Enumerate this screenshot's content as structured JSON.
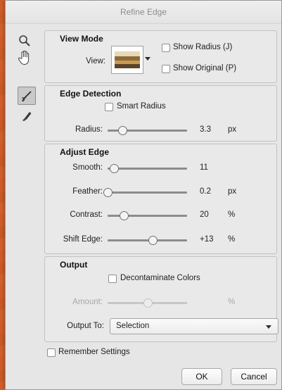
{
  "dialog": {
    "title": "Refine Edge"
  },
  "tools": [
    {
      "name": "zoom-tool",
      "icon": "magnifier-icon"
    },
    {
      "name": "hand-tool",
      "icon": "hand-icon"
    },
    {
      "name": "refine-radius-tool",
      "icon": "brush-icon",
      "selected": true
    },
    {
      "name": "erase-refinements-tool",
      "icon": "eraser-brush-icon"
    }
  ],
  "view_mode": {
    "title": "View Mode",
    "view_label": "View:",
    "show_radius": {
      "label": "Show Radius (J)",
      "checked": false
    },
    "show_original": {
      "label": "Show Original (P)",
      "checked": false
    }
  },
  "edge_detection": {
    "title": "Edge Detection",
    "smart_radius": {
      "label": "Smart Radius",
      "checked": false
    },
    "radius": {
      "label": "Radius:",
      "value": "3.3",
      "unit": "px",
      "slider_fraction": 0.19
    }
  },
  "adjust_edge": {
    "title": "Adjust Edge",
    "smooth": {
      "label": "Smooth:",
      "value": "11",
      "unit": "",
      "slider_fraction": 0.08
    },
    "feather": {
      "label": "Feather:",
      "value": "0.2",
      "unit": "px",
      "slider_fraction": 0.0
    },
    "contrast": {
      "label": "Contrast:",
      "value": "20",
      "unit": "%",
      "slider_fraction": 0.2
    },
    "shift_edge": {
      "label": "Shift Edge:",
      "value": "+13",
      "unit": "%",
      "slider_fraction": 0.565
    }
  },
  "output": {
    "title": "Output",
    "decontaminate": {
      "label": "Decontaminate Colors",
      "checked": false
    },
    "amount": {
      "label": "Amount:",
      "value": "",
      "unit": "%",
      "slider_fraction": 0.5,
      "disabled": true
    },
    "output_to": {
      "label": "Output To:",
      "value": "Selection"
    }
  },
  "remember": {
    "label": "Remember Settings",
    "checked": false
  },
  "buttons": {
    "ok": "OK",
    "cancel": "Cancel"
  },
  "colors": {
    "dialog_bg": "#e6e6e6",
    "group_border": "#c1c1c1",
    "disabled_text": "#a7a7a7"
  }
}
